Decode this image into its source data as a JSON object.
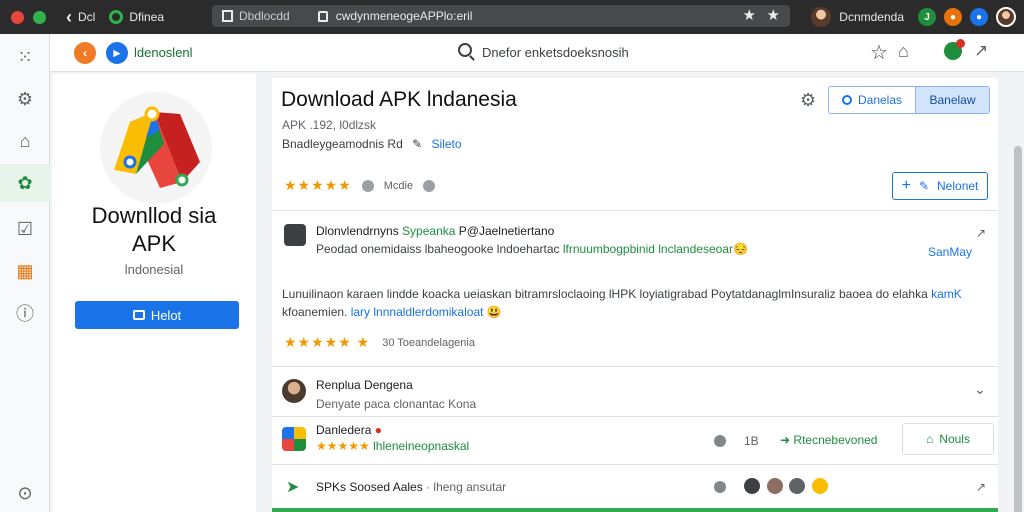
{
  "browser": {
    "tab_short": "Dcl",
    "tab_name": "Dfinea",
    "omni_tab": "Dbdlocdd",
    "url": "cwdynmeneogeAPPlo:eril",
    "user_name": "Dcnmdenda"
  },
  "app_header": {
    "app_name": "ldenoslenl",
    "search_text": "Dnefor enketsdoeksnosih"
  },
  "left_card": {
    "title_line1": "Downllod sia",
    "title_line2": "APK",
    "subtitle": "lndonesial",
    "install_label": "Helot"
  },
  "main": {
    "title": "Download APK lndanesia",
    "meta_line1": "APK .192, l0dlzsk",
    "meta_line2": "Bnadleygeamodnis Rd",
    "meta_link": "Sileto",
    "btn_segment1": "Danelas",
    "btn_segment2": "Banelaw",
    "rating_label": "Mcdie",
    "add_label": "Nelonet",
    "review": {
      "title_a": "Dlonvlendrnyns ",
      "title_g": "Sypeanka",
      "title_b": " P@Jaelnetiertano",
      "line1_a": "Peodad onemidaiss lbaheogooke lndoehartac ",
      "line1_g": "lfrnuumbogpbinid lnclandeseoar",
      "line1_emoji": "😔",
      "side_label": "SanMay",
      "body_a": "Lunuilinaon karaen lindde koacka ueiaskan bitramrsloclaoing lHPK loyiatigrabad PoytatdanaglmInsuraliz baoea do elahka ",
      "body_b1": "kamK",
      "body_c": "kfoanemien.",
      "body_b2": " lary lnnnaldlerdomikaloat",
      "body_emoji": "😃",
      "rating_count": "30 Toeandelagenia"
    }
  },
  "rows": [
    {
      "title": "Renplua Dengena",
      "sub": "Denyate paca clonantac Kona"
    },
    {
      "title": "Danledera",
      "sub": "lhleneineopnaskal",
      "count": "1B",
      "action": "Rtecnebevoned",
      "button": "Nouls"
    },
    {
      "title": "SPKs Soosed Aales",
      "sub": "· lheng ansutar"
    }
  ]
}
